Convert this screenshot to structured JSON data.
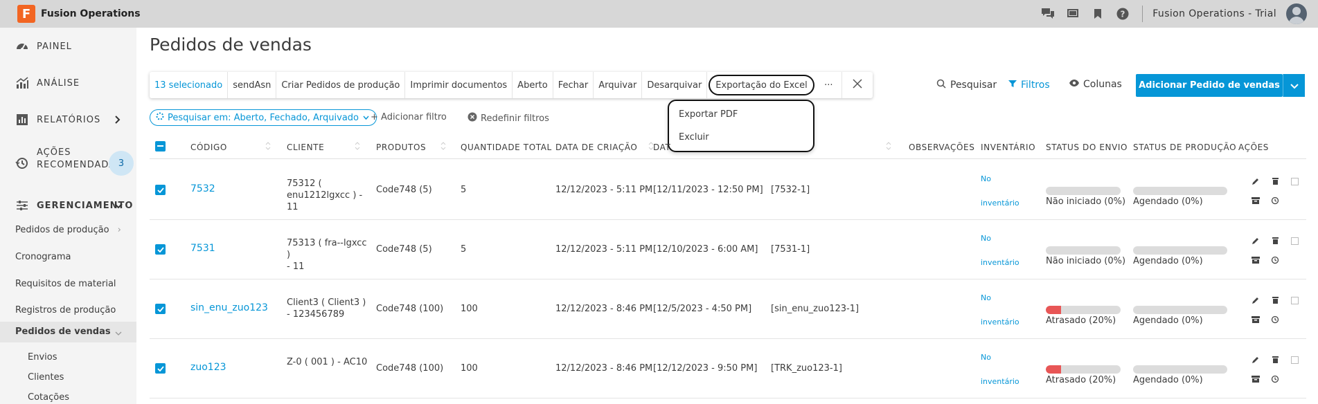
{
  "app": {
    "logo_letter": "F",
    "name": "Fusion Operations",
    "user_label": "Fusion Operations - Trial"
  },
  "colors": {
    "accent": "#0696d7",
    "brand": "#f26522",
    "danger": "#e85656"
  },
  "sidebar": {
    "main": [
      {
        "label": "PAINEL",
        "icon": "dashboard-icon"
      },
      {
        "label": "ANÁLISE",
        "icon": "analytics-icon"
      },
      {
        "label": "RELATÓRIOS",
        "icon": "reports-icon"
      },
      {
        "label1": "AÇÕES",
        "label2": "RECOMENDADAS",
        "badge": "3",
        "icon": "history-icon"
      },
      {
        "label": "GERENCIAMENTO",
        "icon": "sliders-icon"
      }
    ],
    "sub": [
      "Pedidos de produção",
      "Cronograma",
      "Requisitos de material",
      "Registros de produção",
      "Pedidos de vendas"
    ],
    "subsub": [
      "Envios",
      "Clientes",
      "Cotações"
    ]
  },
  "page": {
    "title": "Pedidos de vendas"
  },
  "actionbar": {
    "selected": "13 selecionado",
    "items": [
      "sendAsn",
      "Criar Pedidos de produção",
      "Imprimir documentos",
      "Aberto",
      "Fechar",
      "Arquivar",
      "Desarquivar"
    ],
    "excel": "Exportação do Excel",
    "more": "···"
  },
  "dropdown": {
    "items": [
      "Exportar PDF",
      "Excluir"
    ]
  },
  "toolbar": {
    "search": "Pesquisar",
    "filters": "Filtros",
    "columns": "Colunas",
    "add": "Adicionar Pedido de vendas"
  },
  "filters": {
    "chip": "Pesquisar em: Aberto, Fechado, Arquivado",
    "add": "+ Adicionar filtro",
    "reset": "Redefinir filtros"
  },
  "table": {
    "headers": [
      "CÓDIGO",
      "CLIENTE",
      "PRODUTOS",
      "QUANTIDADE TOTAL",
      "DATA DE CRIAÇÃO",
      "DAT",
      "OBSERVAÇÕES",
      "INVENTÁRIO",
      "STATUS DO ENVIO",
      "STATUS DE PRODUÇÃO",
      "AÇÕES"
    ],
    "rows": [
      {
        "code": "7532",
        "client1": "75312 (",
        "client2": "enu1212lgxcc ) - 11",
        "products": "Code748 (5)",
        "qty": "5",
        "created": "12/12/2023 - 5:11 PM",
        "date": "[12/11/2023 - 12:50 PM]",
        "ref": "[7532-1]",
        "inv1": "No",
        "inv2": "inventário",
        "ship": "Não iniciado (0%)",
        "ship_pct": 0,
        "prod": "Agendado (0%)",
        "prod_pct": 0
      },
      {
        "code": "7531",
        "client1": "75313 ( fra--lgxcc )",
        "client2": "- 11",
        "products": "Code748 (5)",
        "qty": "5",
        "created": "12/12/2023 - 5:11 PM",
        "date": "[12/10/2023 - 6:00 AM]",
        "ref": "[7531-1]",
        "inv1": "No",
        "inv2": "inventário",
        "ship": "Não iniciado (0%)",
        "ship_pct": 0,
        "prod": "Agendado (0%)",
        "prod_pct": 0
      },
      {
        "code": "sin_enu_zuo123",
        "client1": "Client3 ( Client3 )",
        "client2": "- 123456789",
        "products": "Code748 (100)",
        "qty": "100",
        "created": "12/12/2023 - 8:46 PM",
        "date": "[12/5/2023 - 4:50 PM]",
        "ref": "[sin_enu_zuo123-1]",
        "inv1": "No",
        "inv2": "inventário",
        "ship": "Atrasado (20%)",
        "ship_pct": 20,
        "prod": "Agendado (0%)",
        "prod_pct": 0
      },
      {
        "code": "zuo123",
        "client1": "Z-0 ( 001 ) - AC10",
        "client2": "",
        "products": "Code748 (100)",
        "qty": "100",
        "created": "12/12/2023 - 8:46 PM",
        "date": "[12/12/2023 - 9:50 PM]",
        "ref": "[TRK_zuo123-1]",
        "inv1": "No",
        "inv2": "inventário",
        "ship": "Atrasado (20%)",
        "ship_pct": 20,
        "prod": "Agendado (0%)",
        "prod_pct": 0
      }
    ]
  }
}
